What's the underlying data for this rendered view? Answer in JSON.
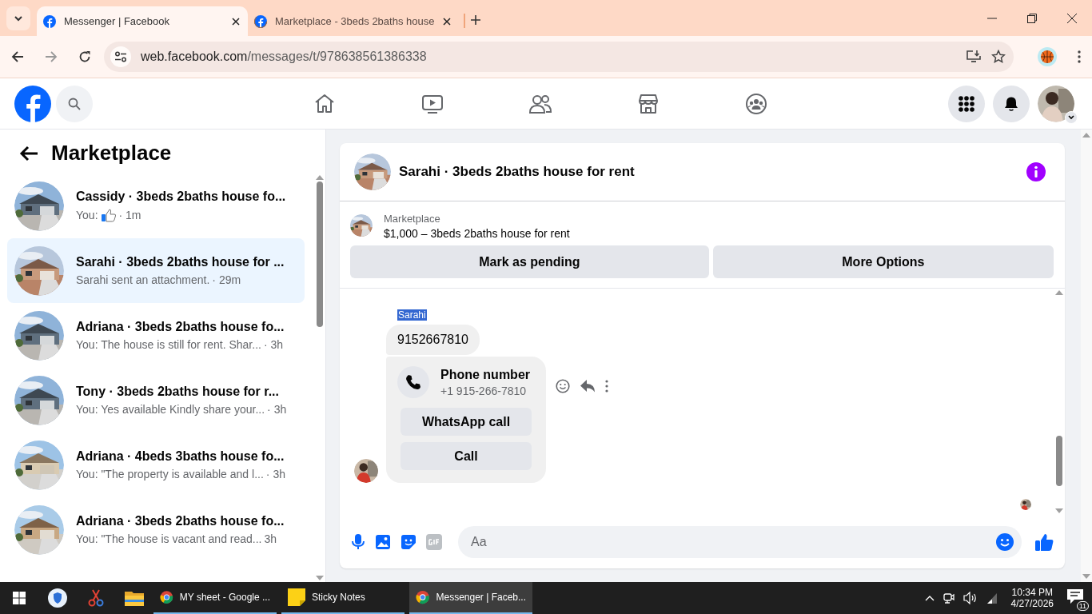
{
  "browser": {
    "tabs": [
      {
        "title": "Messenger | Facebook",
        "selected": true
      },
      {
        "title": "Marketplace - 3beds 2baths house",
        "selected": false
      }
    ],
    "address": {
      "host": "web.facebook.com",
      "path": "/messages/t/978638561386338"
    }
  },
  "sidebar": {
    "title": "Marketplace",
    "conversations": [
      {
        "title": "Cassidy · 3beds 2baths house fo...",
        "preview": "You:",
        "time": "· 1m",
        "kind": "like",
        "selected": false
      },
      {
        "title": "Sarahi · 3beds 2baths house for ...",
        "preview": "Sarahi sent an attachment.",
        "time": "· 29m",
        "kind": "text",
        "selected": true
      },
      {
        "title": "Adriana · 3beds 2baths house fo...",
        "preview": "You: The house is still for rent. Shar...",
        "time": "· 3h",
        "kind": "text",
        "selected": false
      },
      {
        "title": "Tony · 3beds 2baths house for r...",
        "preview": "You: Yes available Kindly share your...",
        "time": "· 3h",
        "kind": "text",
        "selected": false
      },
      {
        "title": "Adriana · 4beds 3baths house fo...",
        "preview": "You: \"The property is available and l...",
        "time": "· 3h",
        "kind": "text",
        "selected": false
      },
      {
        "title": "Adriana · 3beds 2baths house fo...",
        "preview": "You: \"The house is vacant and read...",
        "time": "3h",
        "kind": "text",
        "selected": false
      }
    ]
  },
  "chat": {
    "title": "Sarahi · 3beds 2baths house for rent",
    "listing": {
      "label": "Marketplace",
      "title": "$1,000 – 3beds 2baths house for rent"
    },
    "actions": [
      "Mark as pending",
      "More Options"
    ],
    "message": {
      "sender": "Sarahi",
      "sender_highlighted": true,
      "text": "9152667810",
      "contact_card": {
        "title": "Phone number",
        "number": "+1 915-266-7810",
        "buttons": [
          "WhatsApp call",
          "Call"
        ]
      }
    },
    "composer": {
      "placeholder": "Aa"
    }
  },
  "taskbar": {
    "apps": [
      {
        "label": "MY sheet - Google ...",
        "kind": "chrome",
        "active": false
      },
      {
        "label": "Sticky Notes",
        "kind": "notes",
        "active": false
      },
      {
        "label": "Messenger | Faceb...",
        "kind": "chrome",
        "active": true
      }
    ],
    "time": "10:34 PM",
    "date": "4/27/2026",
    "notifications": "11"
  }
}
